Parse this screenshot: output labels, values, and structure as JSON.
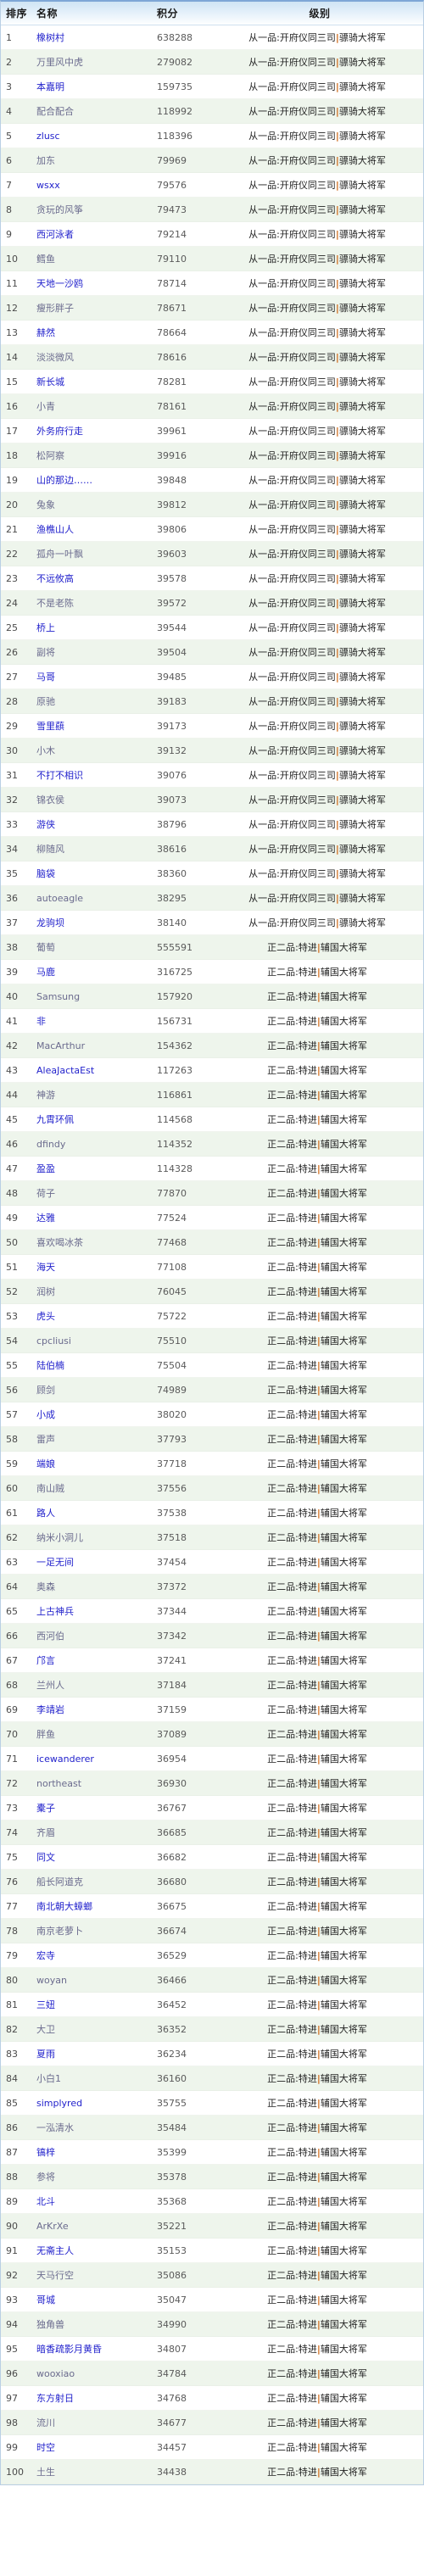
{
  "table": {
    "columns": [
      {
        "key": "rank",
        "label": "排序"
      },
      {
        "key": "name",
        "label": "名称"
      },
      {
        "key": "score",
        "label": "积分"
      },
      {
        "key": "level",
        "label": "级别"
      }
    ],
    "levels": {
      "l1_prefix": "从一品:开府仪同三司",
      "l1_suffix": "骠骑大将军",
      "l2_prefix": "正二品:特进",
      "l2_suffix": "辅国大将军",
      "separator": "|"
    },
    "colors": {
      "header_gradient_top": "#cfe4f4",
      "header_gradient_bottom": "#ffffff",
      "row_odd_bg": "#ffffff",
      "row_even_bg": "#eef5ec",
      "link_odd": "#2222cc",
      "link_even": "#6b6b8e",
      "score_text": "#5a5a5a",
      "separator_color": "#cf6a1a",
      "border_top": "#7ea6d6"
    },
    "rows": [
      {
        "rank": "1",
        "name": "橡树村",
        "score": "638288",
        "level": "l1"
      },
      {
        "rank": "2",
        "name": "万里风中虎",
        "score": "279082",
        "level": "l1"
      },
      {
        "rank": "3",
        "name": "本嘉明",
        "score": "159735",
        "level": "l1"
      },
      {
        "rank": "4",
        "name": "配合配合",
        "score": "118992",
        "level": "l1"
      },
      {
        "rank": "5",
        "name": "zlusc",
        "score": "118396",
        "level": "l1"
      },
      {
        "rank": "6",
        "name": "加东",
        "score": "79969",
        "level": "l1"
      },
      {
        "rank": "7",
        "name": "wsxx",
        "score": "79576",
        "level": "l1"
      },
      {
        "rank": "8",
        "name": "贪玩的风筝",
        "score": "79473",
        "level": "l1"
      },
      {
        "rank": "9",
        "name": "西河泳者",
        "score": "79214",
        "level": "l1"
      },
      {
        "rank": "10",
        "name": "鳕鱼",
        "score": "79110",
        "level": "l1"
      },
      {
        "rank": "11",
        "name": "天地一沙鸥",
        "score": "78714",
        "level": "l1"
      },
      {
        "rank": "12",
        "name": "瘦形胖子",
        "score": "78671",
        "level": "l1"
      },
      {
        "rank": "13",
        "name": "赫然",
        "score": "78664",
        "level": "l1"
      },
      {
        "rank": "14",
        "name": "淡淡微风",
        "score": "78616",
        "level": "l1"
      },
      {
        "rank": "15",
        "name": "新长城",
        "score": "78281",
        "level": "l1"
      },
      {
        "rank": "16",
        "name": "小青",
        "score": "78161",
        "level": "l1"
      },
      {
        "rank": "17",
        "name": "外务府行走",
        "score": "39961",
        "level": "l1"
      },
      {
        "rank": "18",
        "name": "松阿察",
        "score": "39916",
        "level": "l1"
      },
      {
        "rank": "19",
        "name": "山的那边……",
        "score": "39848",
        "level": "l1"
      },
      {
        "rank": "20",
        "name": "兔象",
        "score": "39812",
        "level": "l1"
      },
      {
        "rank": "21",
        "name": "渔樵山人",
        "score": "39806",
        "level": "l1"
      },
      {
        "rank": "22",
        "name": "孤舟一叶飘",
        "score": "39603",
        "level": "l1"
      },
      {
        "rank": "23",
        "name": "不远攸高",
        "score": "39578",
        "level": "l1"
      },
      {
        "rank": "24",
        "name": "不是老陈",
        "score": "39572",
        "level": "l1"
      },
      {
        "rank": "25",
        "name": "桥上",
        "score": "39544",
        "level": "l1"
      },
      {
        "rank": "26",
        "name": "副将",
        "score": "39504",
        "level": "l1"
      },
      {
        "rank": "27",
        "name": "马哥",
        "score": "39485",
        "level": "l1"
      },
      {
        "rank": "28",
        "name": "原驰",
        "score": "39183",
        "level": "l1"
      },
      {
        "rank": "29",
        "name": "雪里蕻",
        "score": "39173",
        "level": "l1"
      },
      {
        "rank": "30",
        "name": "小木",
        "score": "39132",
        "level": "l1"
      },
      {
        "rank": "31",
        "name": "不打不相识",
        "score": "39076",
        "level": "l1"
      },
      {
        "rank": "32",
        "name": "锦衣侯",
        "score": "39073",
        "level": "l1"
      },
      {
        "rank": "33",
        "name": "游侠",
        "score": "38796",
        "level": "l1"
      },
      {
        "rank": "34",
        "name": "柳随风",
        "score": "38616",
        "level": "l1"
      },
      {
        "rank": "35",
        "name": "脑袋",
        "score": "38360",
        "level": "l1"
      },
      {
        "rank": "36",
        "name": "autoeagle",
        "score": "38295",
        "level": "l1"
      },
      {
        "rank": "37",
        "name": "龙驹坝",
        "score": "38140",
        "level": "l1"
      },
      {
        "rank": "38",
        "name": "葡萄",
        "score": "555591",
        "level": "l2"
      },
      {
        "rank": "39",
        "name": "马鹿",
        "score": "316725",
        "level": "l2"
      },
      {
        "rank": "40",
        "name": "Samsung",
        "score": "157920",
        "level": "l2"
      },
      {
        "rank": "41",
        "name": "非",
        "score": "156731",
        "level": "l2"
      },
      {
        "rank": "42",
        "name": "MacArthur",
        "score": "154362",
        "level": "l2"
      },
      {
        "rank": "43",
        "name": "AleaJactaEst",
        "score": "117263",
        "level": "l2"
      },
      {
        "rank": "44",
        "name": "神游",
        "score": "116861",
        "level": "l2"
      },
      {
        "rank": "45",
        "name": "九霄环佩",
        "score": "114568",
        "level": "l2"
      },
      {
        "rank": "46",
        "name": "dfindy",
        "score": "114352",
        "level": "l2"
      },
      {
        "rank": "47",
        "name": "盈盈",
        "score": "114328",
        "level": "l2"
      },
      {
        "rank": "48",
        "name": "荷子",
        "score": "77870",
        "level": "l2"
      },
      {
        "rank": "49",
        "name": "达雅",
        "score": "77524",
        "level": "l2"
      },
      {
        "rank": "50",
        "name": "喜欢喝冰茶",
        "score": "77468",
        "level": "l2"
      },
      {
        "rank": "51",
        "name": "海天",
        "score": "77108",
        "level": "l2"
      },
      {
        "rank": "52",
        "name": "润树",
        "score": "76045",
        "level": "l2"
      },
      {
        "rank": "53",
        "name": "虎头",
        "score": "75722",
        "level": "l2"
      },
      {
        "rank": "54",
        "name": "cpcliusi",
        "score": "75510",
        "level": "l2"
      },
      {
        "rank": "55",
        "name": "陆伯楠",
        "score": "75504",
        "level": "l2"
      },
      {
        "rank": "56",
        "name": "顾剑",
        "score": "74989",
        "level": "l2"
      },
      {
        "rank": "57",
        "name": "小成",
        "score": "38020",
        "level": "l2"
      },
      {
        "rank": "58",
        "name": "雷声",
        "score": "37793",
        "level": "l2"
      },
      {
        "rank": "59",
        "name": "端娘",
        "score": "37718",
        "level": "l2"
      },
      {
        "rank": "60",
        "name": "南山贼",
        "score": "37556",
        "level": "l2"
      },
      {
        "rank": "61",
        "name": "路人",
        "score": "37538",
        "level": "l2"
      },
      {
        "rank": "62",
        "name": "纳米小洞儿",
        "score": "37518",
        "level": "l2"
      },
      {
        "rank": "63",
        "name": "一足无间",
        "score": "37454",
        "level": "l2"
      },
      {
        "rank": "64",
        "name": "奥森",
        "score": "37372",
        "level": "l2"
      },
      {
        "rank": "65",
        "name": "上古神兵",
        "score": "37344",
        "level": "l2"
      },
      {
        "rank": "66",
        "name": "西河伯",
        "score": "37342",
        "level": "l2"
      },
      {
        "rank": "67",
        "name": "邝言",
        "score": "37241",
        "level": "l2"
      },
      {
        "rank": "68",
        "name": "兰州人",
        "score": "37184",
        "level": "l2"
      },
      {
        "rank": "69",
        "name": "李靖岩",
        "score": "37159",
        "level": "l2"
      },
      {
        "rank": "70",
        "name": "胖鱼",
        "score": "37089",
        "level": "l2"
      },
      {
        "rank": "71",
        "name": "icewanderer",
        "score": "36954",
        "level": "l2"
      },
      {
        "rank": "72",
        "name": "northeast",
        "score": "36930",
        "level": "l2"
      },
      {
        "rank": "73",
        "name": "橐子",
        "score": "36767",
        "level": "l2"
      },
      {
        "rank": "74",
        "name": "齐眉",
        "score": "36685",
        "level": "l2"
      },
      {
        "rank": "75",
        "name": "同文",
        "score": "36682",
        "level": "l2"
      },
      {
        "rank": "76",
        "name": "船长阿道克",
        "score": "36680",
        "level": "l2"
      },
      {
        "rank": "77",
        "name": "南北朝大蟑螂",
        "score": "36675",
        "level": "l2"
      },
      {
        "rank": "78",
        "name": "南京老萝卜",
        "score": "36674",
        "level": "l2"
      },
      {
        "rank": "79",
        "name": "宏寺",
        "score": "36529",
        "level": "l2"
      },
      {
        "rank": "80",
        "name": "woyan",
        "score": "36466",
        "level": "l2"
      },
      {
        "rank": "81",
        "name": "三妞",
        "score": "36452",
        "level": "l2"
      },
      {
        "rank": "82",
        "name": "大卫",
        "score": "36352",
        "level": "l2"
      },
      {
        "rank": "83",
        "name": "夏雨",
        "score": "36234",
        "level": "l2"
      },
      {
        "rank": "84",
        "name": "小白1",
        "score": "36160",
        "level": "l2"
      },
      {
        "rank": "85",
        "name": "simplyred",
        "score": "35755",
        "level": "l2"
      },
      {
        "rank": "86",
        "name": "一泓清水",
        "score": "35484",
        "level": "l2"
      },
      {
        "rank": "87",
        "name": "镐梓",
        "score": "35399",
        "level": "l2"
      },
      {
        "rank": "88",
        "name": "参将",
        "score": "35378",
        "level": "l2"
      },
      {
        "rank": "89",
        "name": "北斗",
        "score": "35368",
        "level": "l2"
      },
      {
        "rank": "90",
        "name": "ArKrXe",
        "score": "35221",
        "level": "l2"
      },
      {
        "rank": "91",
        "name": "无斋主人",
        "score": "35153",
        "level": "l2"
      },
      {
        "rank": "92",
        "name": "天马行空",
        "score": "35086",
        "level": "l2"
      },
      {
        "rank": "93",
        "name": "哥城",
        "score": "35047",
        "level": "l2"
      },
      {
        "rank": "94",
        "name": "独角兽",
        "score": "34990",
        "level": "l2"
      },
      {
        "rank": "95",
        "name": "暗香疏影月黄昏",
        "score": "34807",
        "level": "l2"
      },
      {
        "rank": "96",
        "name": "wooxiao",
        "score": "34784",
        "level": "l2"
      },
      {
        "rank": "97",
        "name": "东方射日",
        "score": "34768",
        "level": "l2"
      },
      {
        "rank": "98",
        "name": "流川",
        "score": "34677",
        "level": "l2"
      },
      {
        "rank": "99",
        "name": "时空",
        "score": "34457",
        "level": "l2"
      },
      {
        "rank": "100",
        "name": "土生",
        "score": "34438",
        "level": "l2"
      }
    ]
  }
}
